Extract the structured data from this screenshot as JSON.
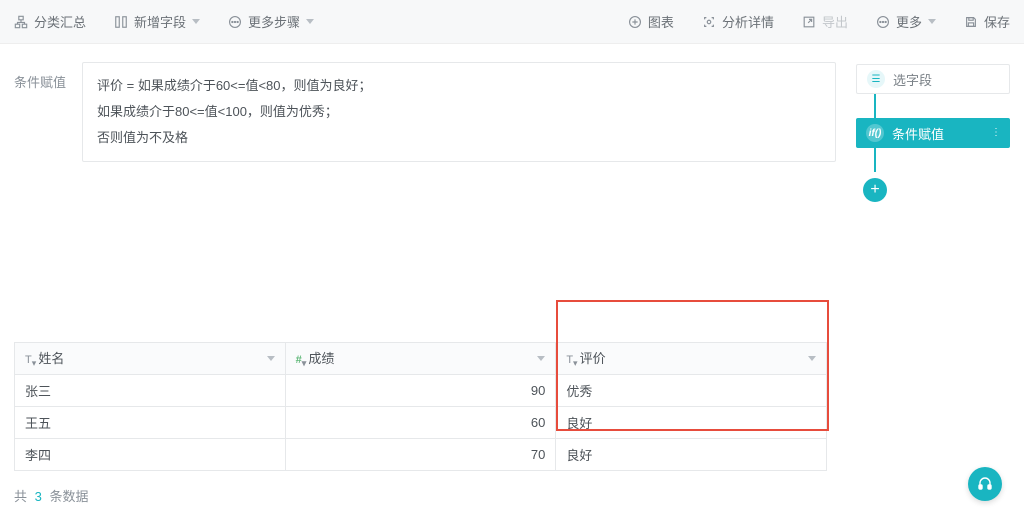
{
  "toolbar": {
    "left": {
      "category": "分类汇总",
      "newfield": "新增字段",
      "moresteps": "更多步骤"
    },
    "right": {
      "chart": "图表",
      "detail": "分析详情",
      "export": "导出",
      "more": "更多",
      "save": "保存"
    }
  },
  "condition": {
    "label": "条件赋值",
    "line1": "评价 = 如果成绩介于60<=值<80，则值为良好；",
    "line2": "如果成绩介于80<=值<100，则值为优秀；",
    "line3": "否则值为不及格"
  },
  "side": {
    "select": "选字段",
    "cond": "条件赋值"
  },
  "table": {
    "headers": {
      "name": "姓名",
      "score": "成绩",
      "rating": "评价"
    },
    "rows": [
      {
        "name": "张三",
        "score": "90",
        "rating": "优秀"
      },
      {
        "name": "王五",
        "score": "60",
        "rating": "良好"
      },
      {
        "name": "李四",
        "score": "70",
        "rating": "良好"
      }
    ]
  },
  "footer": {
    "prefix": "共",
    "count": "3",
    "suffix": "条数据"
  }
}
